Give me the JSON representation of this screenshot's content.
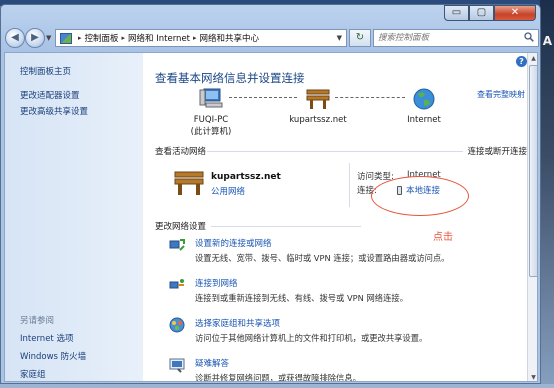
{
  "window": {
    "caption_min": "▭",
    "caption_max": "▢",
    "caption_close": "✕"
  },
  "navigation": {
    "breadcrumb": [
      "控制面板",
      "网络和 Internet",
      "网络和共享中心"
    ],
    "search_placeholder": "搜索控制面板"
  },
  "sidebar": {
    "links": [
      "控制面板主页",
      "更改适配器设置",
      "更改高级共享设置"
    ],
    "see_also_title": "另请参阅",
    "see_also": [
      "Internet 选项",
      "Windows 防火墙",
      "家庭组"
    ]
  },
  "main": {
    "title": "查看基本网络信息并设置连接",
    "view_full_map": "查看完整映射",
    "map_nodes": [
      {
        "label": "FUQI-PC",
        "sublabel": "(此计算机)",
        "icon": "computer-icon"
      },
      {
        "label": "kupartssz.net",
        "icon": "bench-icon"
      },
      {
        "label": "Internet",
        "icon": "globe-icon"
      }
    ],
    "active_networks_label": "查看活动网络",
    "connect_or_disconnect": "连接或断开连接",
    "active_network": {
      "name": "kupartssz.net",
      "type": "公用网络",
      "access_type_label": "访问类型:",
      "access_type_value": "Internet",
      "connection_label": "连接:",
      "connection_value": "本地连接"
    },
    "annotation": "点击",
    "change_settings_label": "更改网络设置",
    "tasks": [
      {
        "title": "设置新的连接或网络",
        "desc": "设置无线、宽带、拨号、临时或 VPN 连接；或设置路由器或访问点。",
        "icon": "new-connection-icon"
      },
      {
        "title": "连接到网络",
        "desc": "连接到或重新连接到无线、有线、拨号或 VPN 网络连接。",
        "icon": "connect-network-icon"
      },
      {
        "title": "选择家庭组和共享选项",
        "desc": "访问位于其他网络计算机上的文件和打印机，或更改共享设置。",
        "icon": "homegroup-icon"
      },
      {
        "title": "疑难解答",
        "desc": "诊断并修复网络问题，或获得故障排除信息。",
        "icon": "troubleshoot-icon"
      }
    ]
  },
  "colors": {
    "link": "#1a55b5",
    "title": "#1c4785",
    "annotation": "#e5563b"
  }
}
